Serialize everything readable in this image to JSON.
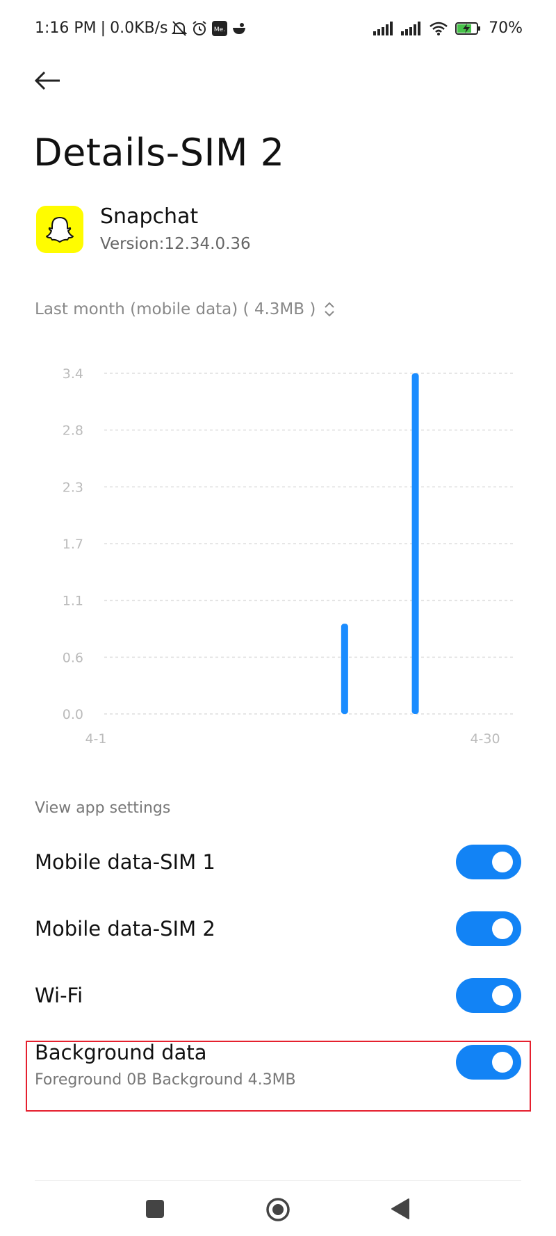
{
  "status_bar": {
    "time": "1:16 PM",
    "separator": "|",
    "net_speed": "0.0KB/s",
    "battery": "70%"
  },
  "page": {
    "title": "Details-SIM 2"
  },
  "app": {
    "name": "Snapchat",
    "version": "Version:12.34.0.36",
    "icon": "snapchat-ghost-icon",
    "icon_color": "#FFFC00"
  },
  "period_selector": {
    "label": "Last month (mobile data) ( 4.3MB )"
  },
  "chart_data": {
    "type": "bar",
    "y_ticks": [
      "3.4",
      "2.8",
      "2.3",
      "1.7",
      "1.1",
      "0.6",
      "0.0"
    ],
    "x_range_labels": [
      "4-1",
      "4-30"
    ],
    "ylim": [
      0,
      3.4
    ],
    "bars": [
      {
        "x": 18,
        "value": 0.9
      },
      {
        "x": 23,
        "value": 3.4
      }
    ],
    "x_min": 1,
    "x_max": 30,
    "bar_color": "#1A8CFF",
    "grid": true
  },
  "settings": {
    "section_label": "View app settings",
    "rows": [
      {
        "label": "Mobile data-SIM 1",
        "on": true
      },
      {
        "label": "Mobile data-SIM 2",
        "on": true
      },
      {
        "label": "Wi-Fi",
        "on": true
      },
      {
        "label": "Background data",
        "sub": "Foreground 0B  Background 4.3MB",
        "on": true
      }
    ]
  },
  "colors": {
    "accent": "#1283F5",
    "highlight": "#E5202E"
  }
}
